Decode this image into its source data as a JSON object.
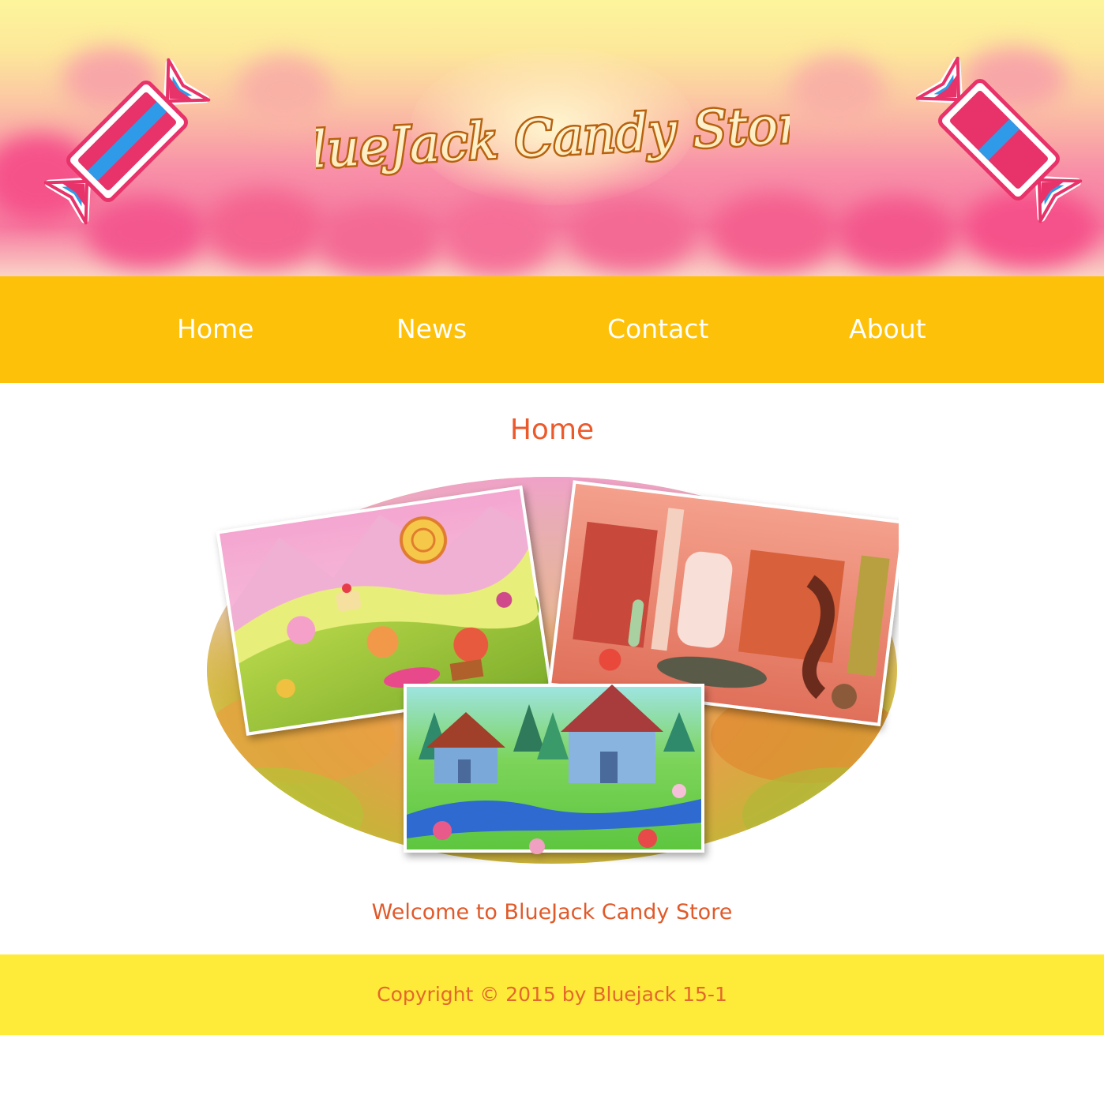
{
  "header": {
    "logo_text": "BlueJack Candy Store",
    "left_candy_icon": "wrapped-candy-icon",
    "right_candy_icon": "wrapped-candy-icon"
  },
  "nav": {
    "items": [
      {
        "label": "Home"
      },
      {
        "label": "News"
      },
      {
        "label": "Contact"
      },
      {
        "label": "About"
      }
    ]
  },
  "main": {
    "title": "Home",
    "gallery": {
      "images": [
        "candy-land-landscape-image",
        "candy-factory-image",
        "candy-village-image"
      ]
    },
    "welcome_text": "Welcome to BlueJack Candy Store"
  },
  "footer": {
    "copyright": "Copyright © 2015 by Bluejack 15-1"
  },
  "colors": {
    "nav_background": "#fdc10a",
    "footer_background": "#feea39",
    "accent_text": "#ec5a2c",
    "nav_text": "#ffffff"
  }
}
